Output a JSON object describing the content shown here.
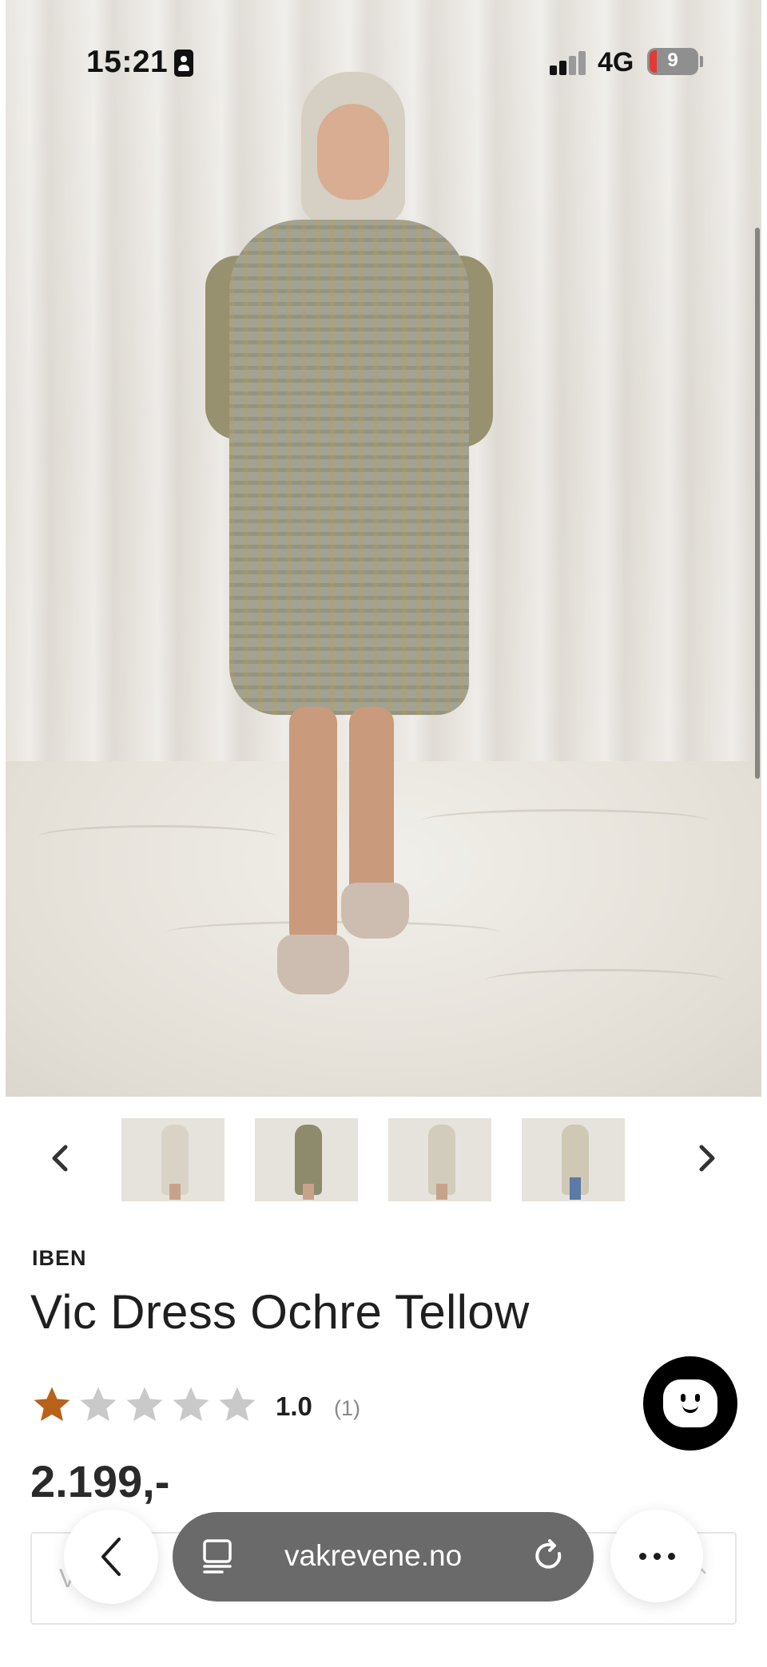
{
  "status_bar": {
    "time": "15:21",
    "network": "4G",
    "battery_level": "9"
  },
  "gallery": {
    "thumbnails": [
      {
        "name": "front-light"
      },
      {
        "name": "back-view"
      },
      {
        "name": "back-light"
      },
      {
        "name": "open-jeans"
      }
    ],
    "prev_icon": "chevron-left-icon",
    "next_icon": "chevron-right-icon"
  },
  "product": {
    "brand": "IBEN",
    "title": "Vic Dress Ochre Tellow",
    "rating": "1.0",
    "rating_count": "(1)",
    "rating_stars_filled": 1,
    "rating_stars_total": 5,
    "price": "2.199,-"
  },
  "variant_select": {
    "placeholder_partial": "V    lør   st",
    "chevron_icon": "chevron-updown-icon"
  },
  "browser": {
    "url": "vakrevene.no",
    "back_icon": "chevron-left-icon",
    "page_icon": "page-menu-icon",
    "reload_icon": "reload-icon",
    "more_icon": "more-icon"
  },
  "colors": {
    "star_filled": "#b8621a",
    "star_empty": "#c9c9c9",
    "url_pill": "#6a6a6a",
    "chat_button": "#000000"
  }
}
